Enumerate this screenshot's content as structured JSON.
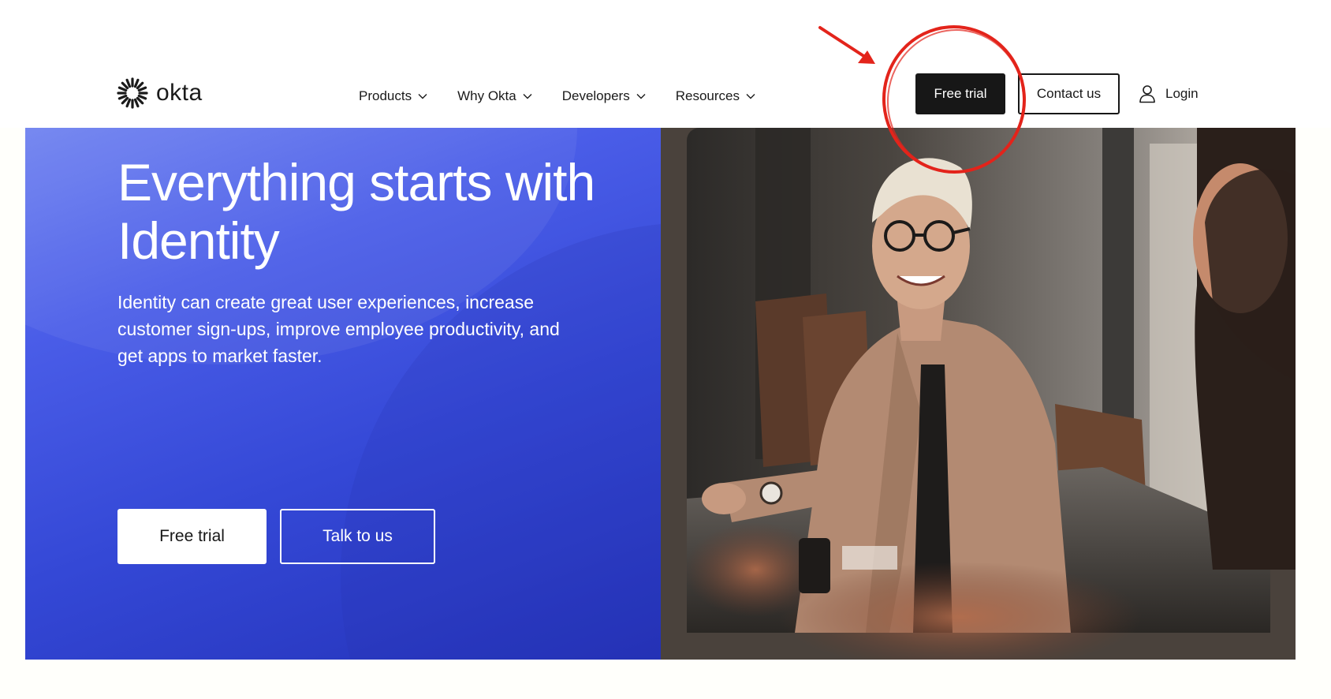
{
  "brand": {
    "name": "okta"
  },
  "nav": {
    "items": [
      {
        "label": "Products"
      },
      {
        "label": "Why Okta"
      },
      {
        "label": "Developers"
      },
      {
        "label": "Resources"
      }
    ]
  },
  "header_actions": {
    "free_trial": "Free trial",
    "contact": "Contact us",
    "login": "Login"
  },
  "hero": {
    "title": "Everything starts with Identity",
    "subtitle": "Identity can create great user experiences, increase customer sign-ups, improve employee productivity, and get apps to market faster.",
    "primary_cta": "Free trial",
    "secondary_cta": "Talk to us"
  },
  "icons": {
    "logo": "okta-sunburst-icon",
    "nav_chevron": "chevron-down-icon",
    "login": "user-icon"
  },
  "colors": {
    "hero_blue": "#3448d6",
    "button_dark": "#171717",
    "annotation_red": "#e3241b"
  }
}
